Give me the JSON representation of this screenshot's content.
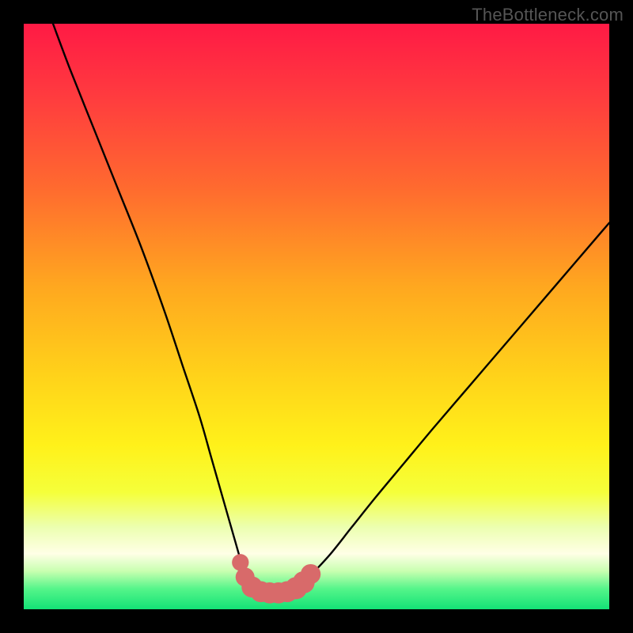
{
  "watermark": {
    "text": "TheBottleneck.com"
  },
  "colors": {
    "black": "#000000",
    "curve": "#000000",
    "marker": "#d86a6a",
    "gradient_stops": [
      {
        "offset": 0.0,
        "color": "#ff1a45"
      },
      {
        "offset": 0.12,
        "color": "#ff3a3f"
      },
      {
        "offset": 0.28,
        "color": "#ff6a2f"
      },
      {
        "offset": 0.45,
        "color": "#ffa81f"
      },
      {
        "offset": 0.6,
        "color": "#ffd21a"
      },
      {
        "offset": 0.72,
        "color": "#fff11a"
      },
      {
        "offset": 0.8,
        "color": "#f5ff3a"
      },
      {
        "offset": 0.86,
        "color": "#ecffb0"
      },
      {
        "offset": 0.905,
        "color": "#ffffe6"
      },
      {
        "offset": 0.935,
        "color": "#c8ffb0"
      },
      {
        "offset": 0.965,
        "color": "#55f58a"
      },
      {
        "offset": 1.0,
        "color": "#13e276"
      }
    ]
  },
  "chart_data": {
    "type": "line",
    "title": "",
    "xlabel": "",
    "ylabel": "",
    "xlim": [
      0,
      100
    ],
    "ylim": [
      0,
      100
    ],
    "grid": false,
    "legend": false,
    "series": [
      {
        "name": "bottleneck-curve",
        "x": [
          5,
          8,
          12,
          16,
          20,
          24,
          27,
          30,
          32,
          34,
          36,
          37.5,
          39,
          41,
          43,
          45,
          48,
          52,
          56,
          60,
          65,
          70,
          76,
          82,
          88,
          94,
          100
        ],
        "y": [
          100,
          92,
          82,
          72,
          62,
          51,
          42,
          33,
          26,
          19,
          12,
          7,
          4,
          3,
          3,
          3.5,
          5,
          9,
          14,
          19,
          25,
          31,
          38,
          45,
          52,
          59,
          66
        ]
      }
    ],
    "markers": {
      "name": "valley-markers",
      "color": "#d86a6a",
      "points": [
        {
          "x": 37.0,
          "y": 8.0,
          "r": 1.0
        },
        {
          "x": 37.8,
          "y": 5.5,
          "r": 1.2
        },
        {
          "x": 39.0,
          "y": 3.8,
          "r": 1.4
        },
        {
          "x": 40.5,
          "y": 3.0,
          "r": 1.4
        },
        {
          "x": 42.0,
          "y": 2.8,
          "r": 1.4
        },
        {
          "x": 43.5,
          "y": 2.8,
          "r": 1.4
        },
        {
          "x": 45.0,
          "y": 3.0,
          "r": 1.4
        },
        {
          "x": 46.5,
          "y": 3.6,
          "r": 1.5
        },
        {
          "x": 47.8,
          "y": 4.6,
          "r": 1.5
        },
        {
          "x": 49.0,
          "y": 6.0,
          "r": 1.3
        }
      ]
    }
  }
}
